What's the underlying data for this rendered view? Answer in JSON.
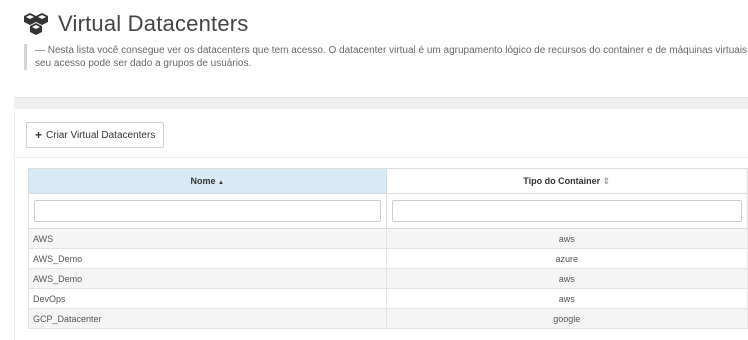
{
  "header": {
    "title": "Virtual Datacenters",
    "icon": "cubes-icon",
    "description": "— Nesta lista você consegue ver os datacenters que tem acesso. O datacenter virtual é um agrupamento lógico de recursos do container e de máquinas virtuais. seu acesso pode ser dado a grupos de usuários."
  },
  "toolbar": {
    "create_label": "Criar Virtual Datacenters",
    "create_icon": "plus-icon"
  },
  "table": {
    "columns": [
      {
        "label": "Nome",
        "sort_indicator": "▲",
        "sorted": true
      },
      {
        "label": "Tipo do Container",
        "sort_indicator": "⇕",
        "sorted": false
      }
    ],
    "filters": [
      "",
      ""
    ],
    "rows": [
      {
        "name": "AWS",
        "type": "aws"
      },
      {
        "name": "AWS_Demo",
        "type": "azure"
      },
      {
        "name": "AWS_Demo",
        "type": "aws"
      },
      {
        "name": "DevOps",
        "type": "aws"
      },
      {
        "name": "GCP_Datacenter",
        "type": "google"
      }
    ]
  },
  "colors": {
    "sorted_header_bg": "#d9eaf7",
    "row_alt_bg": "#f5f5f5"
  }
}
